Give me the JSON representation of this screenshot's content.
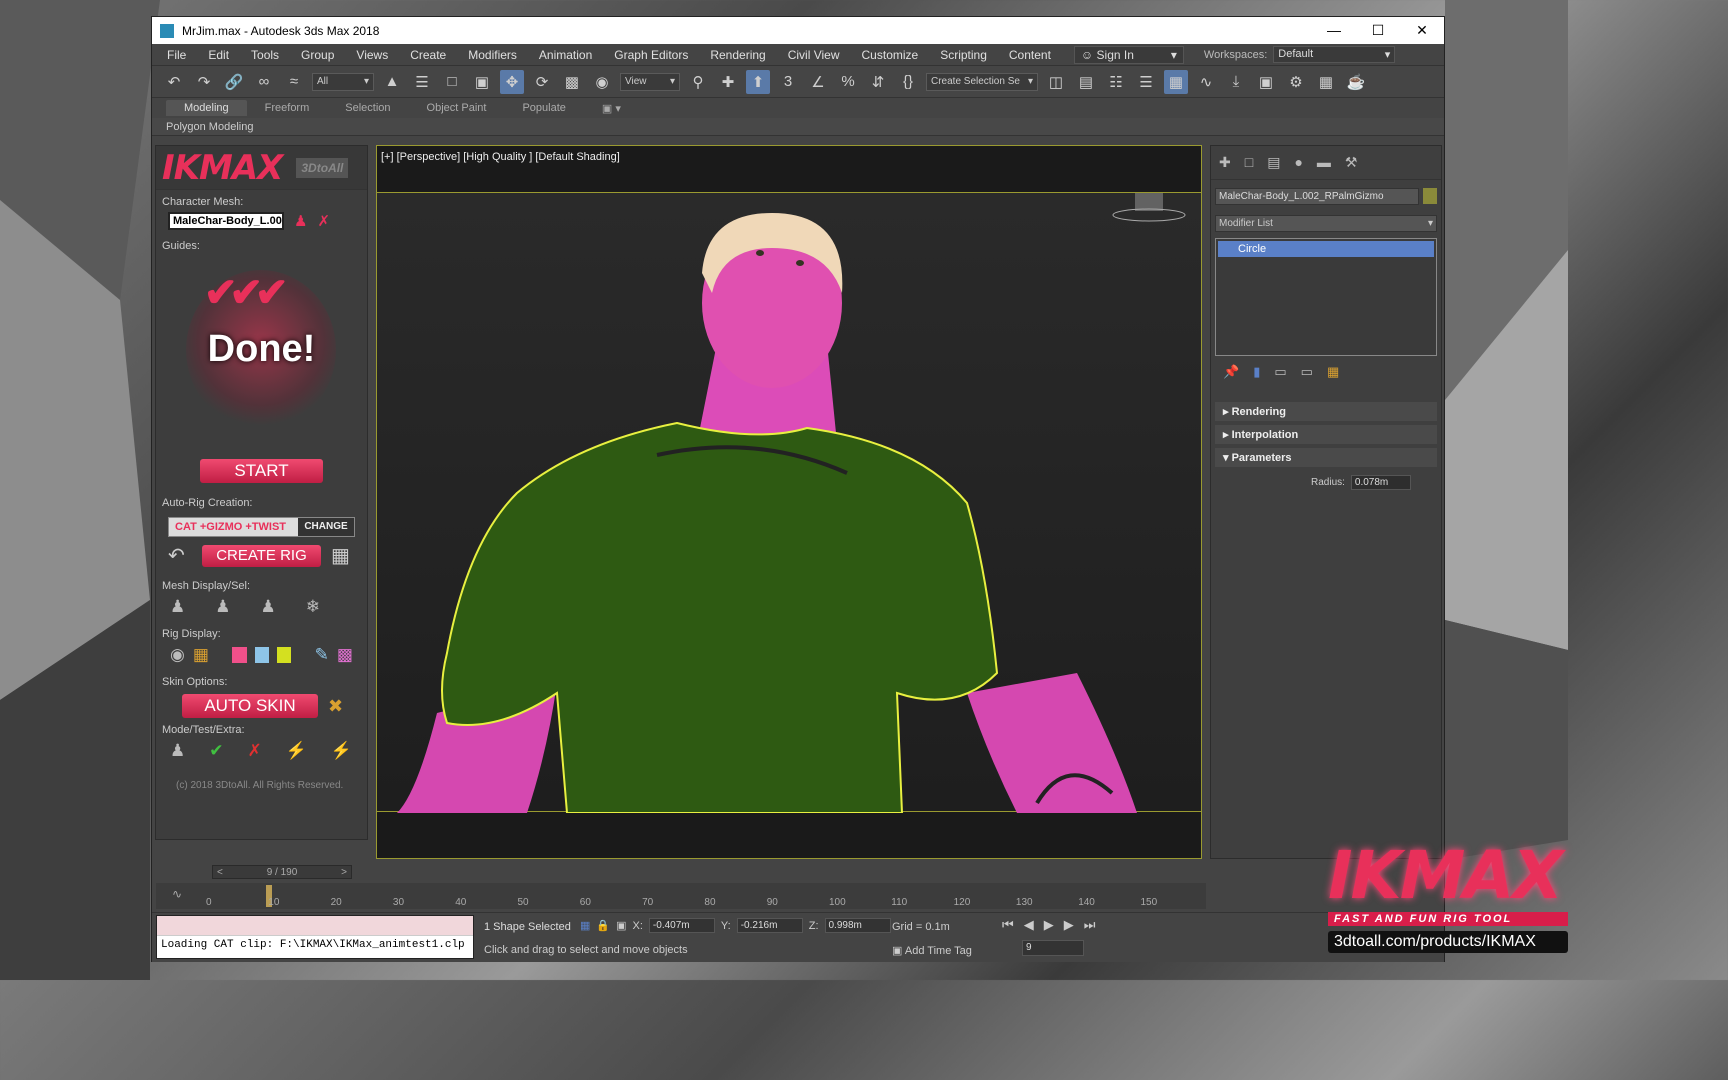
{
  "window": {
    "title": "MrJim.max - Autodesk 3ds Max 2018"
  },
  "menu": {
    "items": [
      "File",
      "Edit",
      "Tools",
      "Group",
      "Views",
      "Create",
      "Modifiers",
      "Animation",
      "Graph Editors",
      "Rendering",
      "Civil View",
      "Customize",
      "Scripting",
      "Content"
    ],
    "sign_in": "Sign In",
    "workspaces_label": "Workspaces:",
    "workspace_value": "Default"
  },
  "toolbar": {
    "filter_value": "All",
    "view_value": "View",
    "selection_set_placeholder": "Create Selection Se"
  },
  "ribbon": {
    "tabs": [
      "Modeling",
      "Freeform",
      "Selection",
      "Object Paint",
      "Populate"
    ],
    "sub_label": "Polygon Modeling"
  },
  "ikmax": {
    "logo_text": "IKMAX",
    "logo_badge": "3DtoAll",
    "character_mesh_label": "Character Mesh:",
    "character_mesh_value": "MaleChar-Body_L.00",
    "guides_label": "Guides:",
    "done_text": "Done!",
    "start_label": "START",
    "autorig_label": "Auto-Rig Creation:",
    "rig_type": "CAT +GIZMO +TWIST",
    "change_label": "CHANGE",
    "create_rig_label": "CREATE RIG",
    "mesh_display_label": "Mesh Display/Sel:",
    "rig_display_label": "Rig Display:",
    "skin_options_label": "Skin Options:",
    "auto_skin_label": "AUTO SKIN",
    "mode_label": "Mode/Test/Extra:",
    "copyright": "(c) 2018 3DtoAll. All Rights Reserved.",
    "rig_colors": [
      "#f0508a",
      "#8ec5e8",
      "#d4e020"
    ]
  },
  "viewport": {
    "label": "[+] [Perspective] [High Quality ] [Default Shading]"
  },
  "command_panel": {
    "object_name": "MaleChar-Body_L.002_RPalmGizmo",
    "modifier_list": "Modifier List",
    "stack_item": "Circle",
    "rollouts": [
      "Rendering",
      "Interpolation",
      "Parameters"
    ],
    "radius_label": "Radius:",
    "radius_value": "0.078m"
  },
  "timeline": {
    "slider_text": "9 / 190",
    "ticks": [
      "0",
      "10",
      "20",
      "30",
      "40",
      "50",
      "60",
      "70",
      "80",
      "90",
      "100",
      "110",
      "120",
      "130",
      "140",
      "150"
    ]
  },
  "status": {
    "maxscript_text": "Loading CAT clip: F:\\IKMAX\\IKMax_animtest1.clp",
    "selected": "1 Shape Selected",
    "hint": "Click and drag to select and move objects",
    "x_label": "X:",
    "x_value": "-0.407m",
    "y_label": "Y:",
    "y_value": "-0.216m",
    "z_label": "Z:",
    "z_value": "0.998m",
    "grid": "Grid = 0.1m",
    "add_time_tag": "Add Time Tag",
    "frame_value": "9"
  },
  "branding": {
    "logo_text": "IKMAX",
    "tagline": "FAST AND FUN RIG TOOL",
    "url": "3dtoall.com/products/IKMAX"
  },
  "colors": {
    "accent": "#e8305a",
    "shirt": "#2e5a12",
    "skin": "#e050b0",
    "highlight": "#e8f040"
  }
}
